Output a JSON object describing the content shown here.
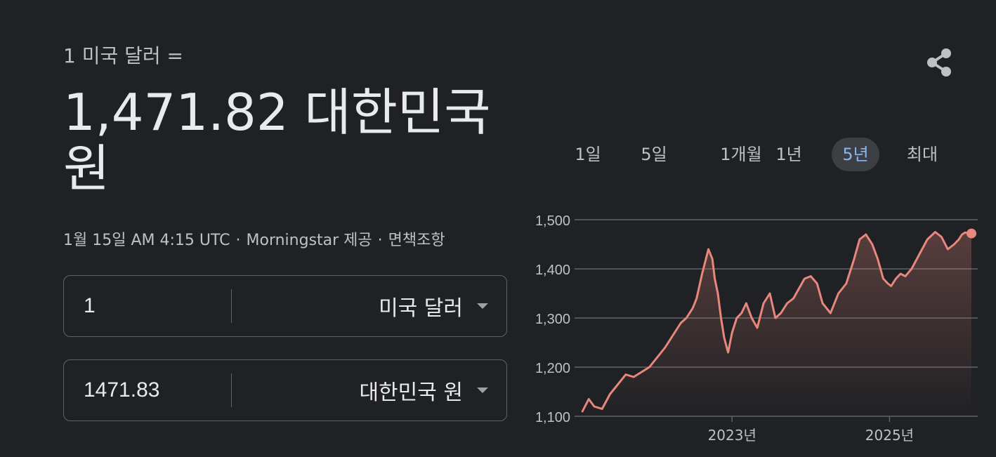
{
  "header": {
    "subtitle": "1 미국 달러 =",
    "value": "1,471.82 대한민국 원",
    "meta": {
      "date": "1월 15일 AM 4:15 UTC",
      "sep1": "·",
      "provider": "Morningstar 제공",
      "sep2": "·",
      "disclaimer": "면책조항"
    }
  },
  "converter": {
    "from": {
      "amount": "1",
      "currency": "미국 달러"
    },
    "to": {
      "amount": "1471.83",
      "currency": "대한민국 원"
    }
  },
  "icons": {
    "share": "share-icon",
    "dropdown": "caret-down-icon"
  },
  "tabs": [
    {
      "label": "1일",
      "active": false
    },
    {
      "label": "5일",
      "active": false
    },
    {
      "label": "1개월",
      "active": false
    },
    {
      "label": "1년",
      "active": false
    },
    {
      "label": "5년",
      "active": true
    },
    {
      "label": "최대",
      "active": false
    }
  ],
  "colors": {
    "background": "#202124",
    "line": "#e8877c",
    "active_tab_text": "#8ab4f8",
    "active_tab_bg": "#3c4043"
  },
  "chart_data": {
    "type": "line",
    "ylim": [
      1100,
      1500
    ],
    "yticks": [
      1500,
      1400,
      1300,
      1200,
      1100
    ],
    "ytick_labels": [
      "1,500",
      "1,400",
      "1,300",
      "1,200",
      "1,100"
    ],
    "xticks": [
      "2023년",
      "2025년"
    ],
    "xtick_positions": [
      2023.0,
      2025.0
    ],
    "grid": true,
    "series": [
      {
        "x": [
          2021.1,
          2021.18,
          2021.25,
          2021.35,
          2021.45,
          2021.55,
          2021.65,
          2021.75,
          2021.85,
          2021.95,
          2022.05,
          2022.15,
          2022.25,
          2022.35,
          2022.42,
          2022.5,
          2022.55,
          2022.62,
          2022.7,
          2022.75,
          2022.78,
          2022.82,
          2022.86,
          2022.9,
          2022.95,
          2023.0,
          2023.06,
          2023.12,
          2023.18,
          2023.25,
          2023.32,
          2023.4,
          2023.48,
          2023.55,
          2023.62,
          2023.7,
          2023.78,
          2023.85,
          2023.92,
          2024.0,
          2024.08,
          2024.15,
          2024.25,
          2024.35,
          2024.45,
          2024.55,
          2024.62,
          2024.7,
          2024.78,
          2024.85,
          2024.92,
          2024.98,
          2025.02,
          2025.08,
          2025.14,
          2025.2,
          2025.28,
          2025.38,
          2025.48,
          2025.58,
          2025.66,
          2025.74,
          2025.82,
          2025.88,
          2025.92,
          2025.96,
          2026.04
        ],
        "values": [
          1110,
          1135,
          1120,
          1115,
          1145,
          1165,
          1185,
          1180,
          1190,
          1200,
          1220,
          1240,
          1265,
          1290,
          1300,
          1320,
          1340,
          1390,
          1440,
          1420,
          1380,
          1350,
          1300,
          1260,
          1230,
          1270,
          1300,
          1310,
          1330,
          1300,
          1280,
          1330,
          1350,
          1300,
          1310,
          1330,
          1340,
          1360,
          1380,
          1385,
          1370,
          1330,
          1310,
          1350,
          1370,
          1420,
          1460,
          1470,
          1450,
          1420,
          1380,
          1370,
          1365,
          1380,
          1390,
          1385,
          1400,
          1430,
          1460,
          1475,
          1465,
          1440,
          1450,
          1460,
          1470,
          1474,
          1472
        ]
      }
    ]
  }
}
